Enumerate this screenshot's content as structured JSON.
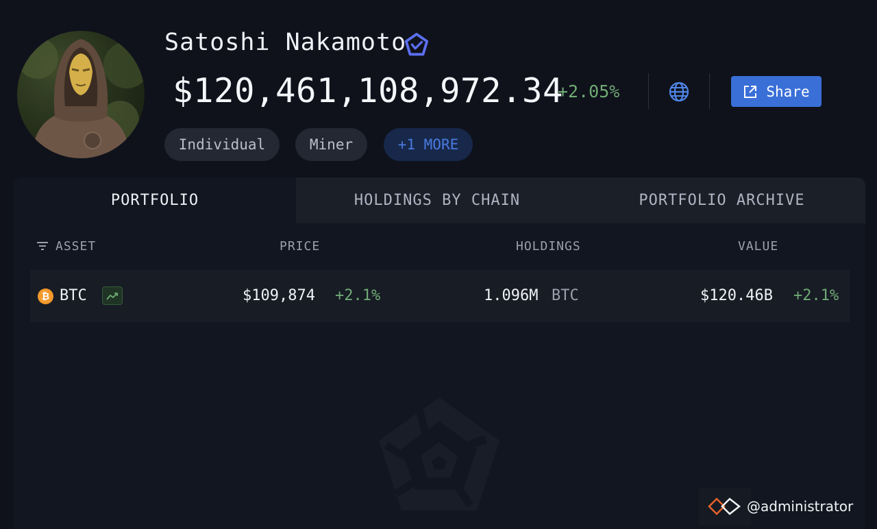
{
  "profile": {
    "name": "Satoshi Nakamoto",
    "avatar_icon": "hooded-statue-avatar",
    "verified_icon": "verified-pentagon-icon",
    "balance": "$120,461,108,972.34",
    "balance_change": "+2.05%",
    "tags": [
      "Individual",
      "Miner"
    ],
    "more_tag": "+1 MORE"
  },
  "actions": {
    "website_icon": "globe-icon",
    "share_label": "Share",
    "share_icon": "external-share-icon"
  },
  "tabs": [
    "PORTFOLIO",
    "HOLDINGS BY CHAIN",
    "PORTFOLIO ARCHIVE"
  ],
  "table": {
    "columns": [
      "ASSET",
      "PRICE",
      "HOLDINGS",
      "VALUE"
    ],
    "rows": [
      {
        "asset": "BTC",
        "asset_icon": "bitcoin-icon",
        "chart_icon": "trend-chart-icon",
        "price": "$109,874",
        "price_change": "+2.1%",
        "holdings_amount": "1.096M",
        "holdings_unit": "BTC",
        "value": "$120.46B",
        "value_change": "+2.1%"
      }
    ]
  },
  "watermark": {
    "credit": "@administrator",
    "credit_icon": "linked-diamonds-icon",
    "logo_icon": "pentagon-logo-watermark"
  },
  "colors": {
    "background": "#0f121b",
    "accent_blue": "#3a6fd8",
    "positive_green": "#6faa74",
    "bitcoin_orange": "#f39a2b"
  }
}
